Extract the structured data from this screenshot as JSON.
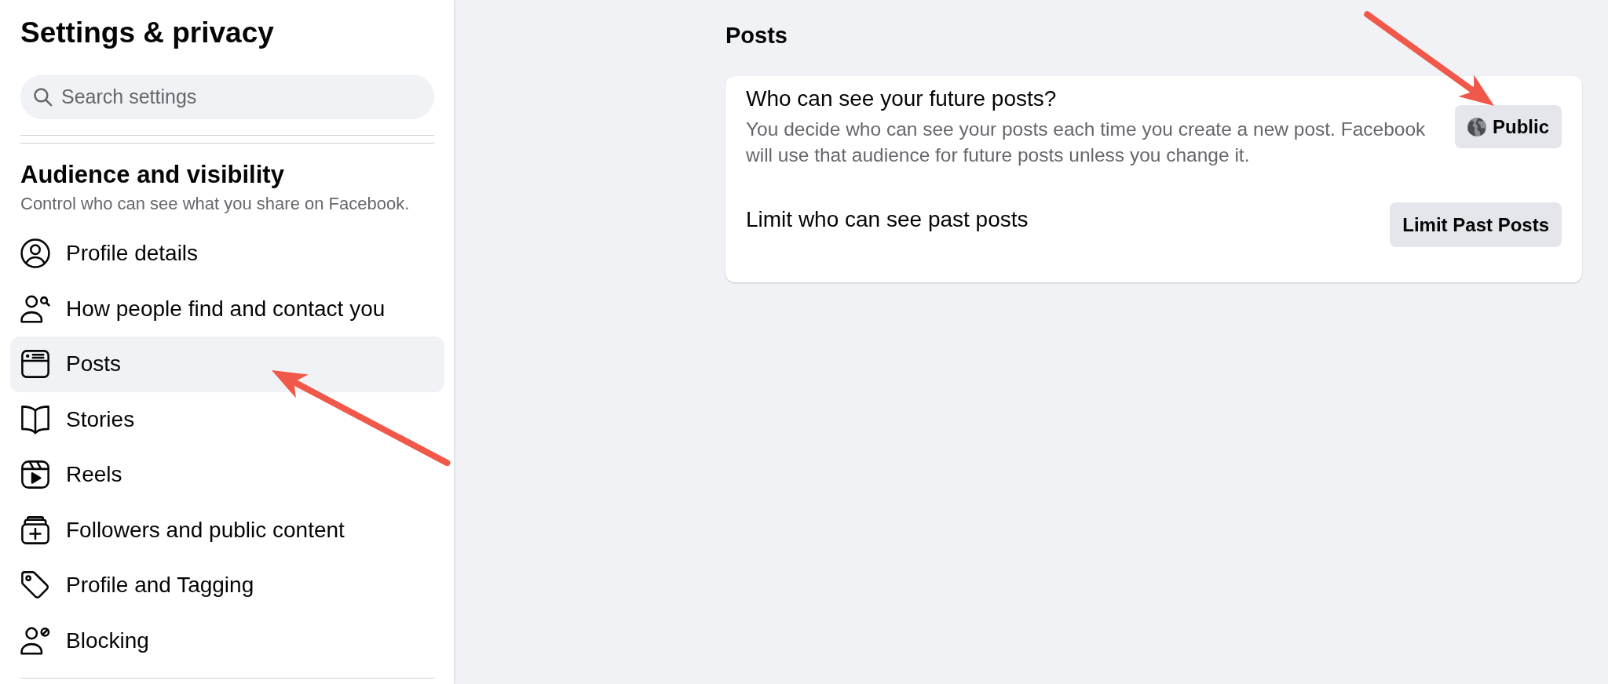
{
  "sidebar": {
    "title": "Settings & privacy",
    "search": {
      "placeholder": "Search settings"
    },
    "section": {
      "title": "Audience and visibility",
      "subtitle": "Control who can see what you share on Facebook."
    },
    "items": [
      {
        "label": "Profile details",
        "selected": false
      },
      {
        "label": "How people find and contact you",
        "selected": false
      },
      {
        "label": "Posts",
        "selected": true
      },
      {
        "label": "Stories",
        "selected": false
      },
      {
        "label": "Reels",
        "selected": false
      },
      {
        "label": "Followers and public content",
        "selected": false
      },
      {
        "label": "Profile and Tagging",
        "selected": false
      },
      {
        "label": "Blocking",
        "selected": false
      }
    ]
  },
  "main": {
    "heading": "Posts",
    "rows": [
      {
        "kind": "audience",
        "title": "Who can see your future posts?",
        "description": "You decide who can see your posts each time you create a new post. Facebook will use that audience for future posts unless you change it.",
        "button": "Public"
      },
      {
        "kind": "action",
        "title": "Limit who can see past posts",
        "button": "Limit Past Posts"
      }
    ]
  }
}
